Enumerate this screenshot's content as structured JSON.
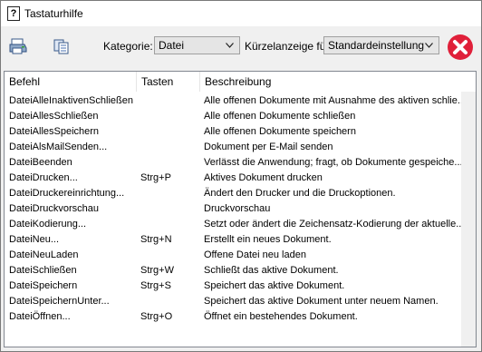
{
  "window": {
    "title": "Tastaturhilfe"
  },
  "toolbar": {
    "print_icon": "printer-icon",
    "copy_icon": "copy-icon",
    "category_label": "Kategorie:",
    "category_value": "Datei",
    "shortcut_label": "Kürzelanzeige für:",
    "shortcut_value": "Standardeinstellung",
    "close_icon": "close-icon",
    "close_color": "#e0203a"
  },
  "table": {
    "columns": [
      "Befehl",
      "Tasten",
      "Beschreibung"
    ],
    "rows": [
      {
        "command": "DateiAlleInaktivenSchließen",
        "keys": "",
        "description": "Alle offenen Dokumente mit Ausnahme des aktiven schlie..."
      },
      {
        "command": "DateiAllesSchließen",
        "keys": "",
        "description": "Alle offenen Dokumente schließen"
      },
      {
        "command": "DateiAllesSpeichern",
        "keys": "",
        "description": "Alle offenen Dokumente speichern"
      },
      {
        "command": "DateiAlsMailSenden...",
        "keys": "",
        "description": "Dokument per E-Mail senden"
      },
      {
        "command": "DateiBeenden",
        "keys": "",
        "description": "Verlässt die Anwendung; fragt, ob Dokumente gespeiche..."
      },
      {
        "command": "DateiDrucken...",
        "keys": "Strg+P",
        "description": "Aktives Dokument drucken"
      },
      {
        "command": "DateiDruckereinrichtung...",
        "keys": "",
        "description": "Ändert den Drucker und die Druckoptionen."
      },
      {
        "command": "DateiDruckvorschau",
        "keys": "",
        "description": "Druckvorschau"
      },
      {
        "command": "DateiKodierung...",
        "keys": "",
        "description": "Setzt oder ändert die Zeichensatz-Kodierung der aktuelle..."
      },
      {
        "command": "DateiNeu...",
        "keys": "Strg+N",
        "description": "Erstellt ein neues Dokument."
      },
      {
        "command": "DateiNeuLaden",
        "keys": "",
        "description": "Offene Datei neu laden"
      },
      {
        "command": "DateiSchließen",
        "keys": "Strg+W",
        "description": "Schließt das aktive Dokument."
      },
      {
        "command": "DateiSpeichern",
        "keys": "Strg+S",
        "description": "Speichert das aktive Dokument."
      },
      {
        "command": "DateiSpeichernUnter...",
        "keys": "",
        "description": "Speichert das aktive Dokument unter neuem Namen."
      },
      {
        "command": "DateiÖffnen...",
        "keys": "Strg+O",
        "description": "Öffnet ein bestehendes Dokument."
      }
    ]
  }
}
